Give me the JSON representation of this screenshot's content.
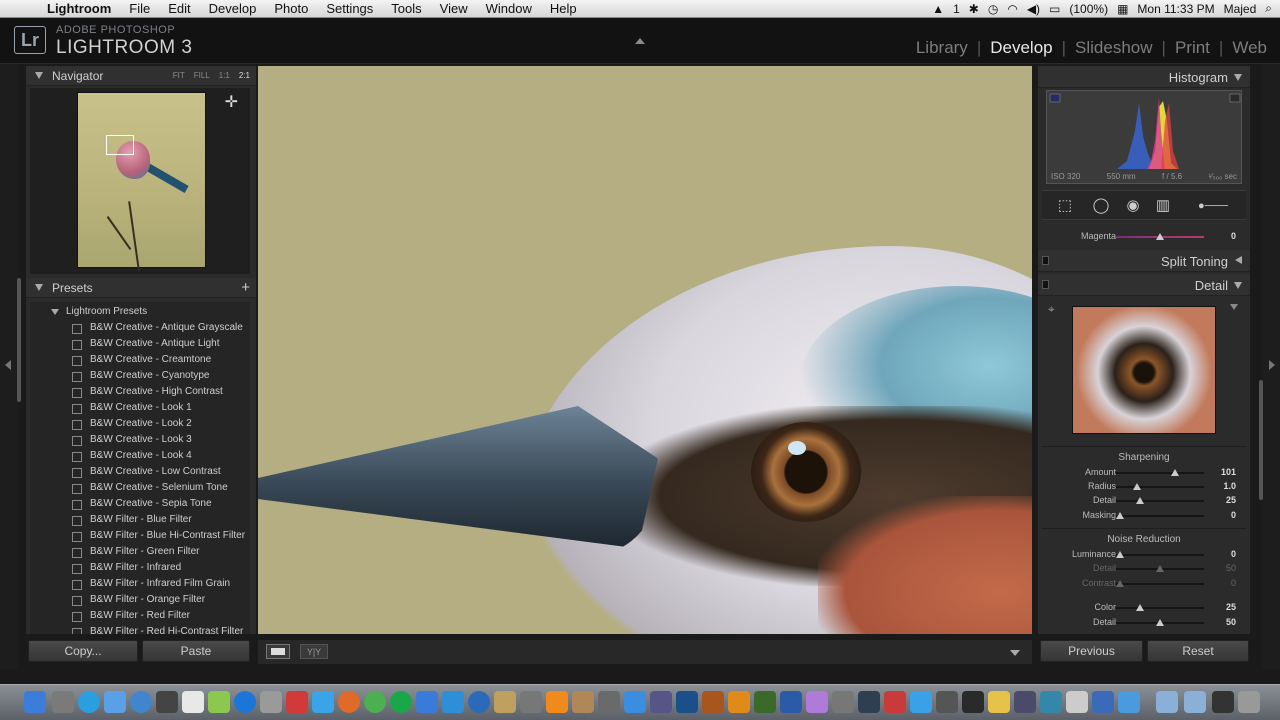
{
  "menubar": {
    "app": "Lightroom",
    "items": [
      "File",
      "Edit",
      "Develop",
      "Photo",
      "Settings",
      "Tools",
      "View",
      "Window",
      "Help"
    ],
    "battery": "(100%)",
    "clock": "Mon 11:33 PM",
    "user": "Majed",
    "badge": "1"
  },
  "header": {
    "brand_top": "ADOBE PHOTOSHOP",
    "brand_main": "LIGHTROOM 3",
    "logo": "Lr",
    "modules": [
      "Library",
      "Develop",
      "Slideshow",
      "Print",
      "Web"
    ],
    "active_module": "Develop"
  },
  "navigator": {
    "title": "Navigator",
    "zoom_options": [
      "FIT",
      "FILL",
      "1:1",
      "2:1"
    ],
    "active_zoom": "2:1"
  },
  "presets": {
    "title": "Presets",
    "folder": "Lightroom Presets",
    "items": [
      "B&W Creative - Antique Grayscale",
      "B&W Creative - Antique Light",
      "B&W Creative - Creamtone",
      "B&W Creative - Cyanotype",
      "B&W Creative - High Contrast",
      "B&W Creative - Look 1",
      "B&W Creative - Look 2",
      "B&W Creative - Look 3",
      "B&W Creative - Look 4",
      "B&W Creative - Low Contrast",
      "B&W Creative - Selenium Tone",
      "B&W Creative - Sepia Tone",
      "B&W Filter - Blue Filter",
      "B&W Filter - Blue Hi-Contrast Filter",
      "B&W Filter - Green Filter",
      "B&W Filter - Infrared",
      "B&W Filter - Infrared Film Grain",
      "B&W Filter - Orange Filter",
      "B&W Filter - Red Filter",
      "B&W Filter - Red Hi-Contrast Filter"
    ]
  },
  "left_buttons": {
    "copy": "Copy...",
    "paste": "Paste"
  },
  "histogram": {
    "title": "Histogram",
    "iso": "ISO 320",
    "focal": "550 mm",
    "aperture": "f / 5.6",
    "shutter": "¹⁄₅₀₀ sec"
  },
  "split_toning": {
    "title": "Split Toning"
  },
  "magenta": {
    "label": "Magenta",
    "value": "0",
    "level": 0.5
  },
  "detail": {
    "title": "Detail",
    "sharpening_title": "Sharpening",
    "sharpening": [
      {
        "label": "Amount",
        "value": "101",
        "level": 0.67
      },
      {
        "label": "Radius",
        "value": "1.0",
        "level": 0.24
      },
      {
        "label": "Detail",
        "value": "25",
        "level": 0.27
      },
      {
        "label": "Masking",
        "value": "0",
        "level": 0.05
      }
    ],
    "noise_title": "Noise Reduction",
    "noise": [
      {
        "label": "Luminance",
        "value": "0",
        "level": 0.05,
        "dim": false
      },
      {
        "label": "Detail",
        "value": "50",
        "level": 0.5,
        "dim": true
      },
      {
        "label": "Contrast",
        "value": "0",
        "level": 0.05,
        "dim": true
      },
      {
        "label": "Color",
        "value": "25",
        "level": 0.27,
        "dim": false
      },
      {
        "label": "Detail",
        "value": "50",
        "level": 0.5,
        "dim": false
      }
    ]
  },
  "right_buttons": {
    "previous": "Previous",
    "reset": "Reset"
  },
  "filmstrip": {
    "yy": "Y|Y"
  }
}
